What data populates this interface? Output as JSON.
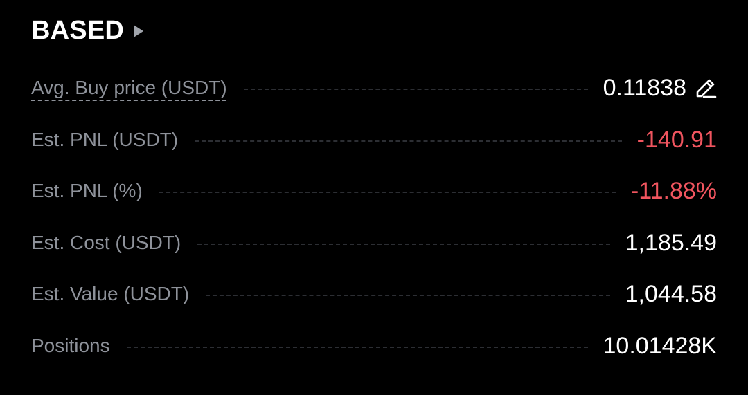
{
  "header": {
    "asset": "BASED",
    "arrow_icon": "caret-right-icon"
  },
  "colors": {
    "background": "#000000",
    "label": "#8e929a",
    "value": "#ffffff",
    "negative": "#f0555f"
  },
  "rows": [
    {
      "label": "Avg. Buy price (USDT)",
      "value": "0.11838",
      "icon": "pencil-edit-icon"
    },
    {
      "label": "Est. PNL (USDT)",
      "value": "-140.91"
    },
    {
      "label": "Est. PNL (%)",
      "value": "-11.88%"
    },
    {
      "label": "Est. Cost (USDT)",
      "value": "1,185.49"
    },
    {
      "label": "Est. Value (USDT)",
      "value": "1,044.58"
    },
    {
      "label": "Positions",
      "value": "10.01428K"
    }
  ]
}
